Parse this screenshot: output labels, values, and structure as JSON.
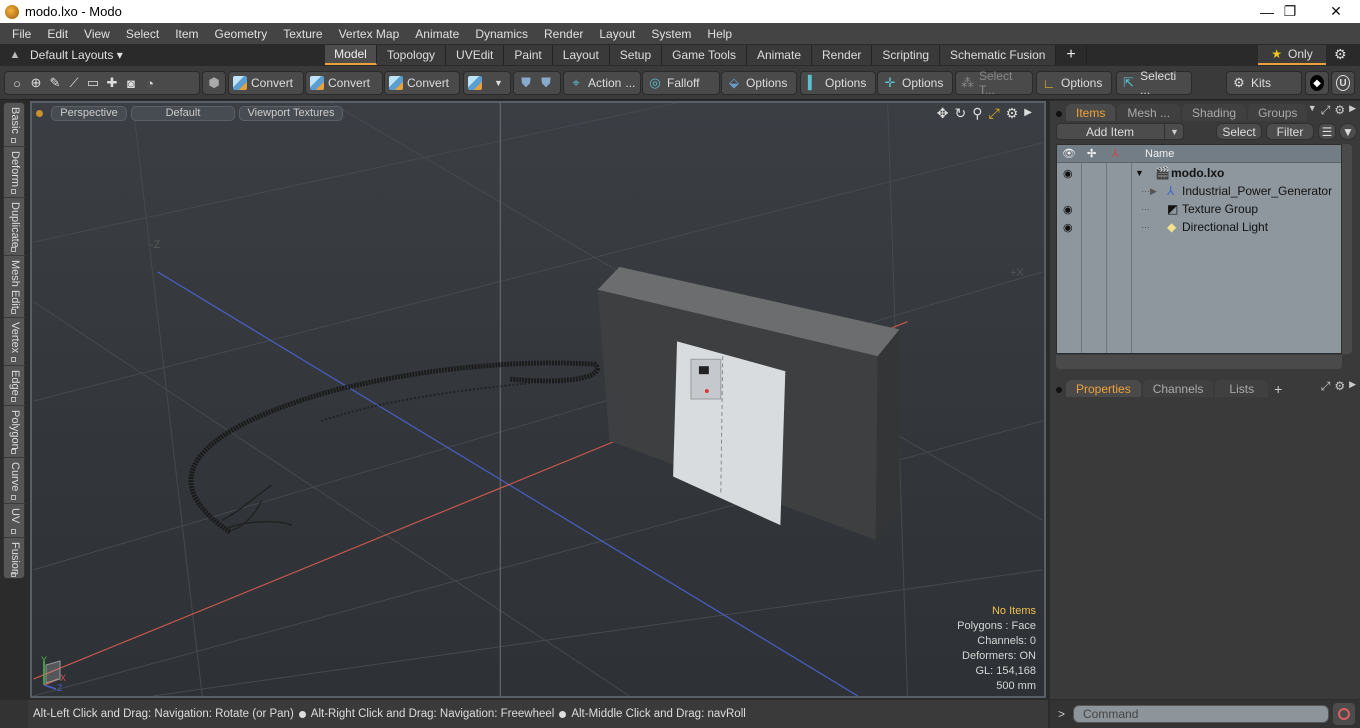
{
  "window": {
    "title": "modo.lxo - Modo",
    "controls": {
      "minimize": "—",
      "maximize": "❐",
      "close": "✕"
    }
  },
  "menu": [
    "File",
    "Edit",
    "View",
    "Select",
    "Item",
    "Geometry",
    "Texture",
    "Vertex Map",
    "Animate",
    "Dynamics",
    "Render",
    "Layout",
    "System",
    "Help"
  ],
  "layoutbar": {
    "layouts_label": "Default Layouts ▾",
    "tabs": [
      "Model",
      "Topology",
      "UVEdit",
      "Paint",
      "Layout",
      "Setup",
      "Game Tools",
      "Animate",
      "Render",
      "Scripting",
      "Schematic Fusion"
    ],
    "active_tab": "Model",
    "add_tab": "+",
    "only_label": "Only"
  },
  "toolbar": {
    "convert1": "Convert",
    "convert2": "Convert",
    "convert3": "Convert",
    "action": "Action",
    "action_more": "...",
    "falloff": "Falloff",
    "options1": "Options",
    "options2": "Options",
    "options3": "Options",
    "select_t": "Select T...",
    "options4": "Options",
    "selecti": "Selecti ...",
    "kits": "Kits"
  },
  "left_tabs": [
    "Basic",
    "Deform",
    "Duplicate",
    "Mesh Edit",
    "Vertex",
    "Edge",
    "Polygon",
    "Curve",
    "UV",
    "Fusion"
  ],
  "viewport": {
    "view_mode": "Perspective",
    "shading": "Default",
    "textures": "Viewport Textures",
    "axis_neg_z": "-Z",
    "axis_pos_x": "+X",
    "gizmo": {
      "y": "Y",
      "x": "X",
      "z": "Z"
    },
    "stats": {
      "selection": "No Items",
      "polygons": "Polygons : Face",
      "channels": "Channels: 0",
      "deformers": "Deformers: ON",
      "gl": "GL: 154,168",
      "scale": "500 mm"
    }
  },
  "statusbar": {
    "hint1": "Alt-Left Click and Drag: Navigation: Rotate (or Pan)",
    "hint2": "Alt-Right Click and Drag: Navigation: Freewheel",
    "hint3": "Alt-Middle Click and Drag: navRoll"
  },
  "items_panel": {
    "tabs": [
      "Items",
      "Mesh ...",
      "Shading",
      "Groups"
    ],
    "active_tab": "Items",
    "add_item": "Add Item",
    "select": "Select",
    "filter": "Filter",
    "column_name": "Name",
    "tree": [
      {
        "name": "modo.lxo",
        "visible": true,
        "bold": true,
        "icon": "scene-icon"
      },
      {
        "name": "Industrial_Power_Generator",
        "visible": false,
        "icon": "mesh-locator-icon"
      },
      {
        "name": "Texture Group",
        "visible": true,
        "icon": "texture-group-icon"
      },
      {
        "name": "Directional Light",
        "visible": true,
        "icon": "light-icon"
      }
    ]
  },
  "properties_panel": {
    "tabs": [
      "Properties",
      "Channels",
      "Lists"
    ],
    "active_tab": "Properties",
    "add_tab": "+"
  },
  "command": {
    "prompt": ">",
    "placeholder": "Command"
  },
  "colors": {
    "accent": "#e9a13a",
    "x_axis": "#c8574c",
    "z_axis": "#4a5fc8",
    "stats_highlight": "#f0c050"
  }
}
